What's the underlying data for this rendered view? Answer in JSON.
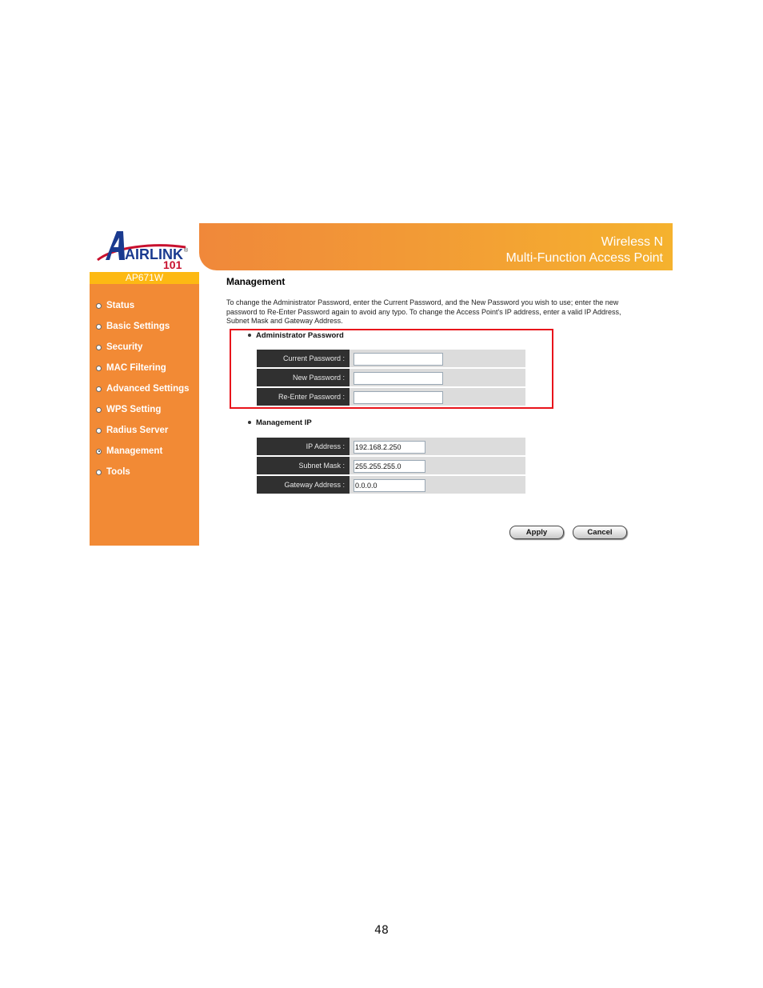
{
  "brand": {
    "logo_text": "AIRLINK",
    "logo_number": "101",
    "registered_mark": "®"
  },
  "banner": {
    "line1": "Wireless N",
    "line2": "Multi-Function Access Point"
  },
  "sidebar": {
    "model": "AP671W",
    "items": [
      {
        "label": "Status",
        "selected": false
      },
      {
        "label": "Basic Settings",
        "selected": false
      },
      {
        "label": "Security",
        "selected": false
      },
      {
        "label": "MAC Filtering",
        "selected": false
      },
      {
        "label": "Advanced Settings",
        "selected": false
      },
      {
        "label": "WPS Setting",
        "selected": false
      },
      {
        "label": "Radius Server",
        "selected": false
      },
      {
        "label": "Management",
        "selected": true
      },
      {
        "label": "Tools",
        "selected": false
      }
    ]
  },
  "main": {
    "title": "Management",
    "intro": "To change the Administrator Password, enter the Current Password, and the New Password you wish to use; enter the new password to Re-Enter Password again to avoid any typo. To change the Access Point's IP address, enter a valid IP Address, Subnet Mask and Gateway Address.",
    "admin_section": {
      "title": "Administrator Password",
      "fields": [
        {
          "label": "Current Password :",
          "value": ""
        },
        {
          "label": "New Password :",
          "value": ""
        },
        {
          "label": "Re-Enter Password :",
          "value": ""
        }
      ]
    },
    "ip_section": {
      "title": "Management IP",
      "fields": [
        {
          "label": "IP Address :",
          "value": "192.168.2.250"
        },
        {
          "label": "Subnet Mask :",
          "value": "255.255.255.0"
        },
        {
          "label": "Gateway Address :",
          "value": "0.0.0.0"
        }
      ]
    },
    "buttons": {
      "apply": "Apply",
      "cancel": "Cancel"
    }
  },
  "colors": {
    "sidebar_orange": "#f28a35",
    "model_bar_yellow": "#fdb913",
    "highlight_red": "#e8141b",
    "label_dark": "#303030",
    "field_gray": "#dcdcdc"
  },
  "page_number": "48"
}
